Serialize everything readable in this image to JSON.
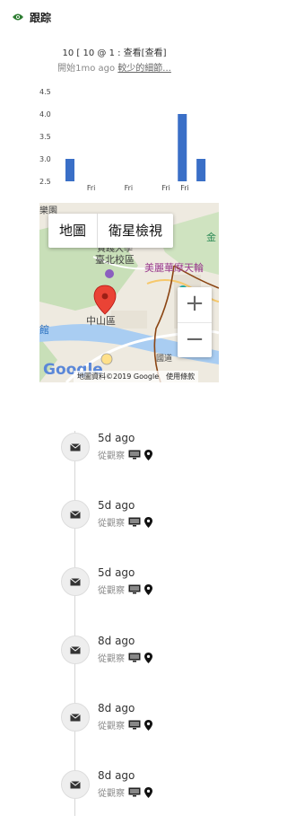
{
  "header": {
    "title": "跟踪",
    "icon": "eye-icon",
    "accent": "#2e7d32"
  },
  "summary": {
    "line1": "10 [ 10 @ 1 : 查看[查看]",
    "line2_prefix": "開始1mo ago ",
    "line2_link": "較少的細節..."
  },
  "chart_data": {
    "type": "bar",
    "yticks": [
      "4.5",
      "4.0",
      "3.5",
      "3.0",
      "2.5"
    ],
    "ylim": [
      2.5,
      4.5
    ],
    "xtick_labels": [
      "Fri",
      "Fri",
      "Fri",
      "Fri"
    ],
    "values": [
      3.0,
      0,
      0,
      0,
      0,
      0,
      4.0,
      3.0
    ],
    "bar_color": "#3a6fc7"
  },
  "map": {
    "btn_map": "地圖",
    "btn_satellite": "衛星檢視",
    "zoom_in": "+",
    "zoom_out": "−",
    "attribution": "地圖資料©2019 Google",
    "terms": "使用條款",
    "labels": {
      "school": "臺北校區",
      "district": "中山區",
      "ferris": "美麗華摩天輪",
      "top": "貫踐大學",
      "left": "館",
      "top_left": "樂園",
      "right": "金",
      "google": "Google",
      "road": "國道"
    }
  },
  "events": [
    {
      "time": "5d ago",
      "source": "從觀察"
    },
    {
      "time": "5d ago",
      "source": "從觀察"
    },
    {
      "time": "5d ago",
      "source": "從觀察"
    },
    {
      "time": "8d ago",
      "source": "從觀察"
    },
    {
      "time": "8d ago",
      "source": "從觀察"
    },
    {
      "time": "8d ago",
      "source": "從觀察"
    }
  ]
}
